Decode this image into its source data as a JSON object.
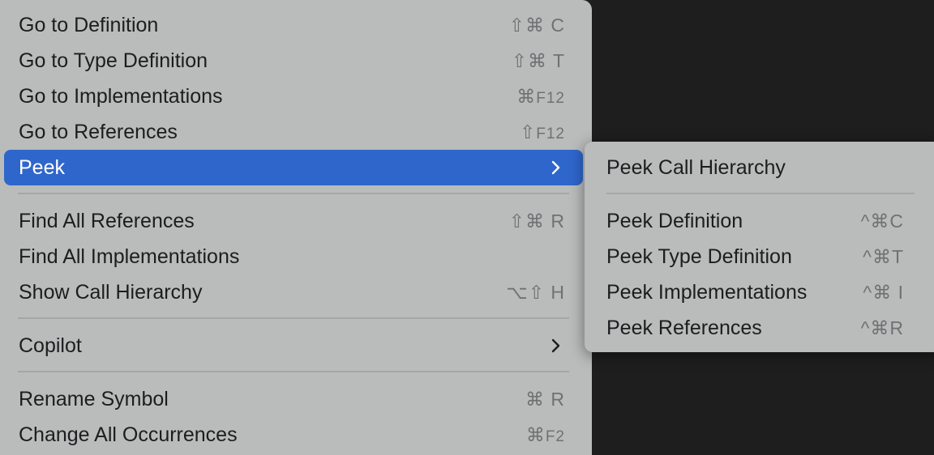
{
  "menu": {
    "items": [
      {
        "label": "Go to Definition",
        "shortcut": "⇧⌘ C"
      },
      {
        "label": "Go to Type Definition",
        "shortcut": "⇧⌘ T"
      },
      {
        "label": "Go to Implementations",
        "shortcut": "⌘",
        "shortcut_small": "F12"
      },
      {
        "label": "Go to References",
        "shortcut": "⇧",
        "shortcut_small": "F12"
      },
      {
        "label": "Peek"
      },
      {
        "label": "Find All References",
        "shortcut": "⇧⌘ R"
      },
      {
        "label": "Find All Implementations"
      },
      {
        "label": "Show Call Hierarchy",
        "shortcut": "⌥⇧ H"
      },
      {
        "label": "Copilot"
      },
      {
        "label": "Rename Symbol",
        "shortcut": "⌘ R"
      },
      {
        "label": "Change All Occurrences",
        "shortcut": "⌘",
        "shortcut_small": "F2"
      }
    ]
  },
  "submenu": {
    "items": [
      {
        "label": "Peek Call Hierarchy"
      },
      {
        "label": "Peek Definition",
        "shortcut": "^⌘C"
      },
      {
        "label": "Peek Type Definition",
        "shortcut": "^⌘T"
      },
      {
        "label": "Peek Implementations",
        "shortcut": "^⌘ I"
      },
      {
        "label": "Peek References",
        "shortcut": "^⌘R"
      }
    ]
  },
  "colors": {
    "menu_bg": "#b9bcbb",
    "highlight": "#2f66cb",
    "editor_bg": "#1e1e1e"
  }
}
